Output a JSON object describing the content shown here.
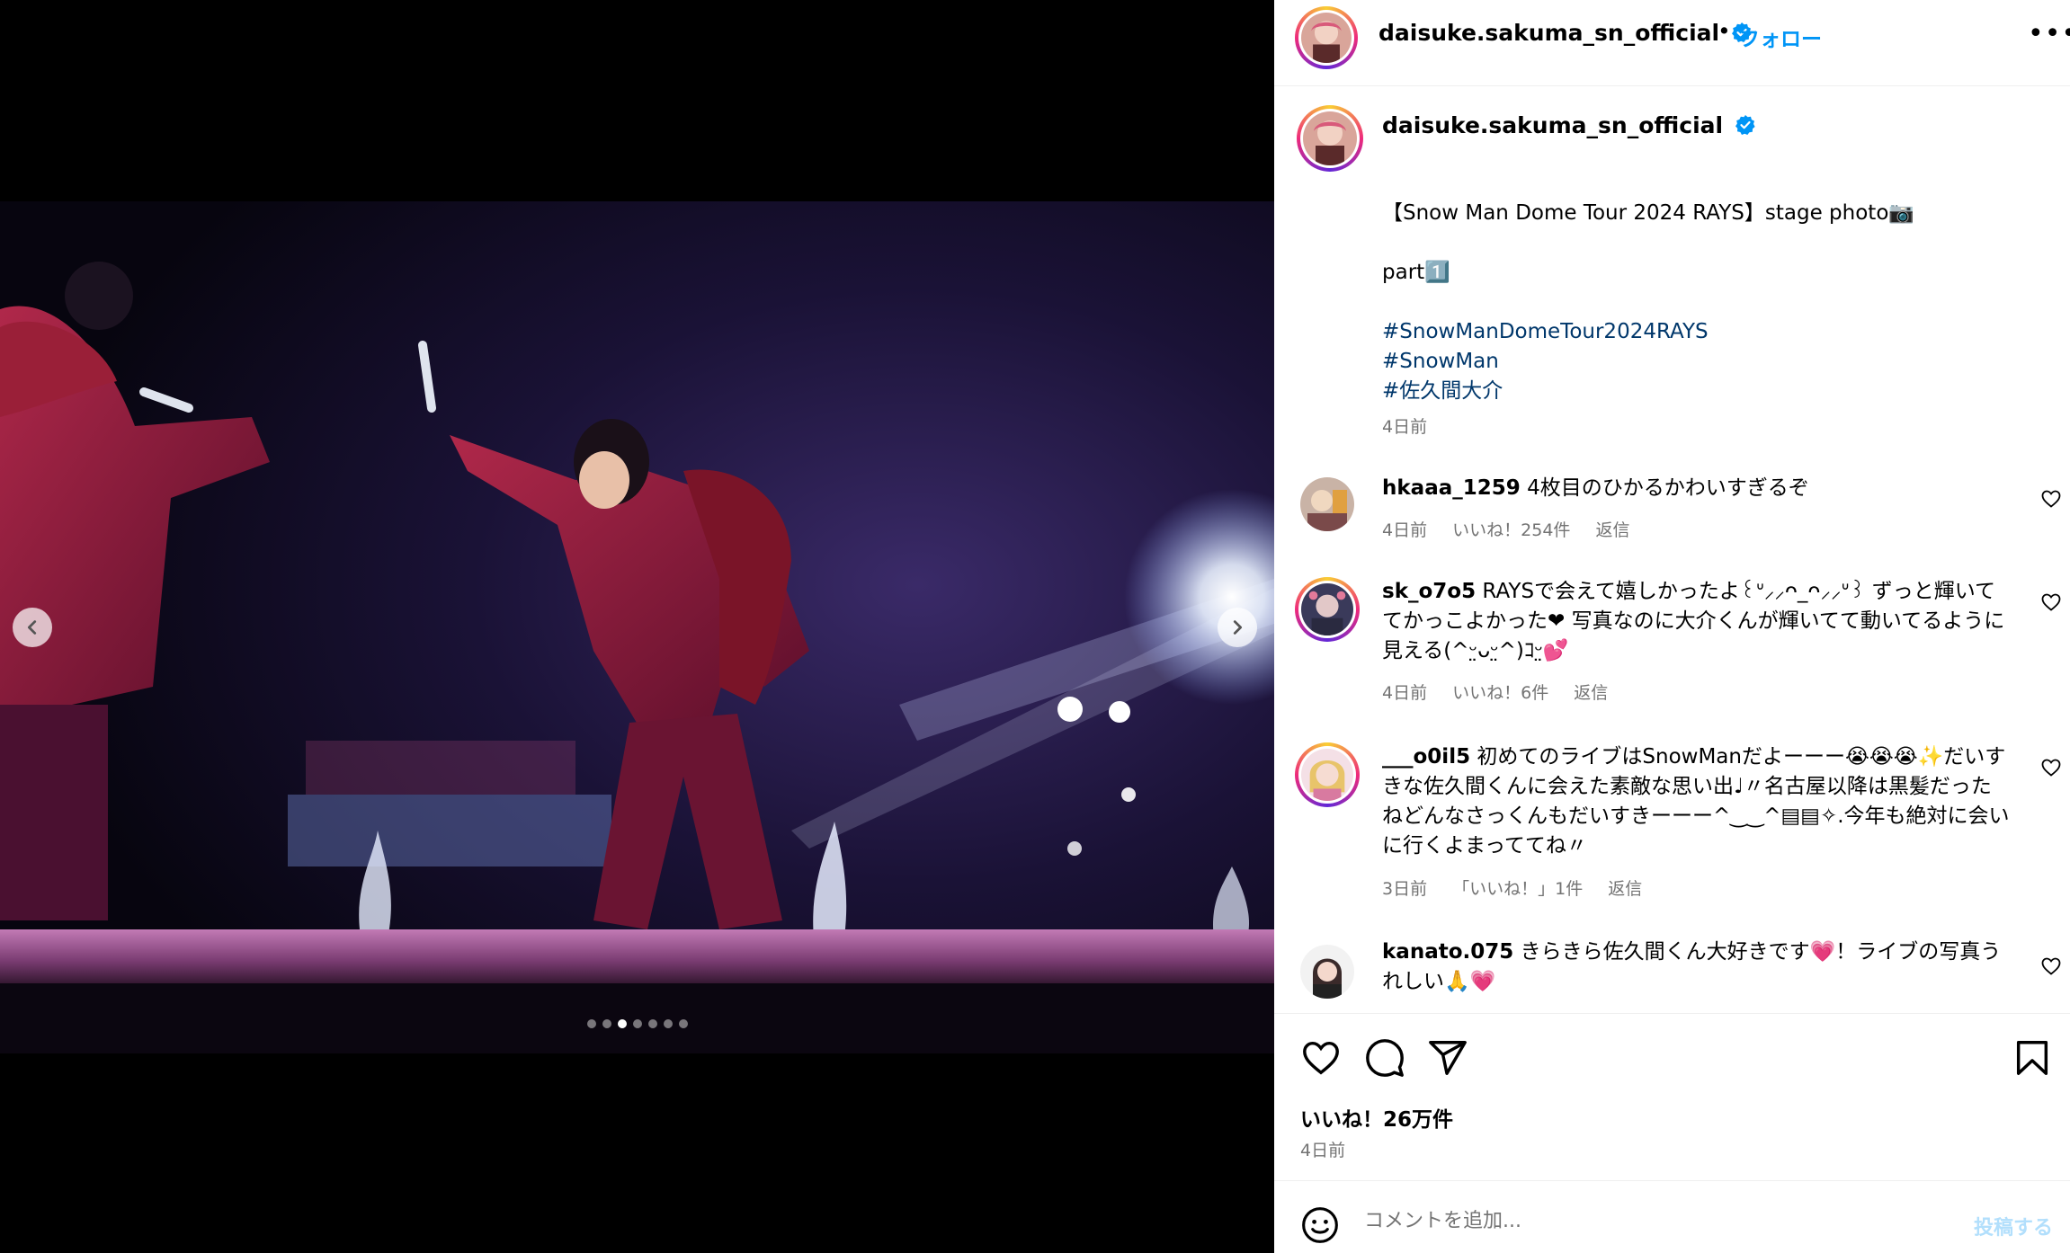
{
  "post": {
    "username": "daisuke.sakuma_sn_official",
    "follow_label": "フォロー",
    "separator": "•",
    "more_label": "•••",
    "carousel": {
      "slide_count": 7,
      "active_index": 2
    },
    "caption": {
      "line1": "【Snow Man Dome Tour 2024 RAYS】stage photo📷",
      "line2": "part1️⃣",
      "hashtags": [
        "#SnowManDomeTour2024RAYS",
        "#SnowMan",
        "#佐久間大介"
      ],
      "time": "4日前"
    },
    "likes": "いいね！26万件",
    "date": "4日前"
  },
  "comments": [
    {
      "username": "hkaaa_1259",
      "text": "4枚目のひかるかわいすぎるぞ",
      "time": "4日前",
      "likes": "いいね！254件",
      "reply": "返信"
    },
    {
      "username": "sk_o7o5",
      "text": "RAYSで会えて嬉しかったよ꒰ᐡ⸝⸝ᴖ_ᴖ⸝⸝ᐡ꒱ ずっと輝いててかっこよかった❤ 写真なのに大介くんが輝いてて動いてるように見える(^ᵕ̤ᴗᵕ̤^)ｺᵕ̤💕",
      "time": "4日前",
      "likes": "いいね！6件",
      "reply": "返信"
    },
    {
      "username": "___o0il5",
      "text": "初めてのライブはSnowManだよーーー😭😭😭✨だいすきな佐久間くんに会えた素敵な思い出♩〃名古屋以降は黒髪だったねどんなさっくんもだいすきーーー^‿‿^▤▤✧.今年も絶対に会いに行くよまっててね〃",
      "time": "3日前",
      "likes": "「いいね！」1件",
      "reply": "返信"
    },
    {
      "username": "kanato.075",
      "text": "きらきら佐久間くん大好きです💗！ライブの写真うれしい🙏💗",
      "time": "",
      "likes": "",
      "reply": ""
    }
  ],
  "composer": {
    "placeholder": "コメントを追加...",
    "post_label": "投稿する"
  },
  "icons": {
    "verified": "verified-badge-icon",
    "heart": "heart-icon",
    "comment": "comment-icon",
    "share": "share-icon",
    "save": "bookmark-icon",
    "emoji": "emoji-icon",
    "prev": "chevron-left-icon",
    "next": "chevron-right-icon"
  },
  "colors": {
    "accent": "#0095f6",
    "hashtag": "#00376b",
    "muted": "#737373",
    "post_disabled": "#b2dffc"
  }
}
